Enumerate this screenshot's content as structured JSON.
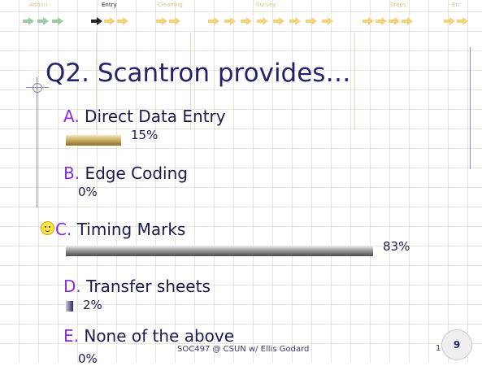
{
  "nav": {
    "tabs": [
      {
        "label": "Admin",
        "active": false
      },
      {
        "label": "Entry",
        "active": true
      },
      {
        "label": "Cleaning",
        "active": false
      },
      {
        "label": "Survey",
        "active": false
      },
      {
        "label": "Steps",
        "active": false
      },
      {
        "label": "Etc",
        "active": false
      }
    ]
  },
  "slide": {
    "title": "Q2. Scantron provides…",
    "correct_option": "C",
    "options": [
      {
        "letter": "A.",
        "text": "Direct Data Entry",
        "percent_label": "15%",
        "percent": 15,
        "bar_color": "gold"
      },
      {
        "letter": "B.",
        "text": "Edge Coding",
        "percent_label": "0%",
        "percent": 0,
        "bar_color": "none"
      },
      {
        "letter": "C.",
        "text": "Timing Marks",
        "percent_label": "83%",
        "percent": 83,
        "bar_color": "gray"
      },
      {
        "letter": "D.",
        "text": "Transfer sheets",
        "percent_label": "2%",
        "percent": 2,
        "bar_color": "navy"
      },
      {
        "letter": "E.",
        "text": "None of the above",
        "percent_label": "0%",
        "percent": 0,
        "bar_color": "none"
      }
    ]
  },
  "footer": {
    "text": "SOC497 @ CSUN w/ Ellis Godard",
    "slide_number_partial": "1",
    "page_number": "9"
  },
  "colors": {
    "title": "#22246b",
    "letter": "#8a2be2",
    "bar_gold": "#c4a65a",
    "bar_gray": "#8c8c8c",
    "bar_navy": "#2b2b5a"
  }
}
